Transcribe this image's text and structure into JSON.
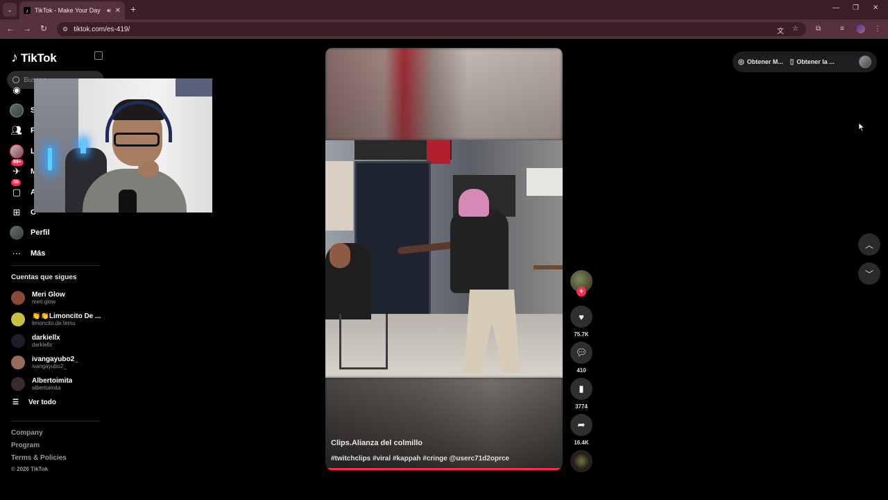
{
  "browser": {
    "tab_title": "TikTok - Make Your Day",
    "url": "tiktok.com/es-419/"
  },
  "sidebar": {
    "logo_text": "TikTok",
    "search_placeholder": "Buscar",
    "nav_items": [
      {
        "label": "",
        "icon": "home-icon"
      },
      {
        "label": "S",
        "icon": "avatar"
      },
      {
        "label": "F",
        "icon": "friends-icon"
      },
      {
        "label": "L",
        "icon": "live-avatar"
      },
      {
        "label": "M",
        "icon": "messages-icon",
        "badge": "99+"
      },
      {
        "label": "A",
        "icon": "activity-icon",
        "badge": "35"
      },
      {
        "label": "C",
        "icon": "upload-icon"
      },
      {
        "label": "Perfil",
        "icon": "profile-avatar"
      },
      {
        "label": "Más",
        "icon": "more-icon"
      }
    ],
    "following_title": "Cuentas que sigues",
    "following": [
      {
        "name": "Meri Glow",
        "handle": "meri.glow",
        "color": "#8a4a3a"
      },
      {
        "name": "👏👏Limoncito De ...",
        "handle": "limoncito.de.temu",
        "color": "#c8c040"
      },
      {
        "name": "darkiellx",
        "handle": "darkiellx",
        "color": "#1a1f2a"
      },
      {
        "name": "ivangayubo2_",
        "handle": "ivangayubo2_",
        "color": "#9a6a5a"
      },
      {
        "name": "Albertoimita",
        "handle": "albertoimita",
        "color": "#3a2a2a"
      }
    ],
    "see_all": "Ver todo",
    "footer_links": [
      "Company",
      "Program",
      "Terms & Policies"
    ],
    "copyright": "© 2026 TikTok"
  },
  "video": {
    "title": "Clips.Alianza del colmillo",
    "tags": "#twitchclips #viral #kappah #cringe @userc71d2oprce",
    "progress_fraction": 1.0
  },
  "actions": {
    "likes": "75.7K",
    "comments": "410",
    "saves": "3774",
    "shares": "16.4K"
  },
  "topbar": {
    "get_coins": "Obtener M...",
    "get_app": "Obtener la ..."
  },
  "colors": {
    "accent": "#fe2c55",
    "tab_bar": "#3a1e28",
    "toolbar": "#55303e"
  }
}
